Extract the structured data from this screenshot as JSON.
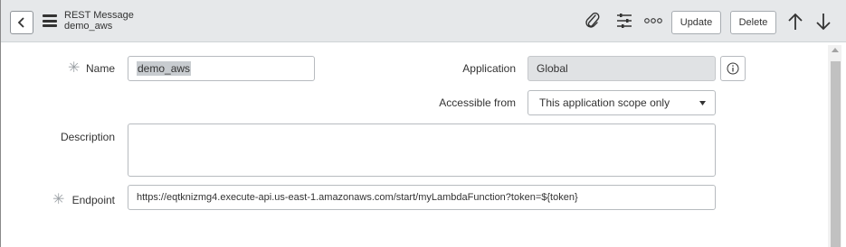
{
  "header": {
    "record_type": "REST Message",
    "record_name": "demo_aws",
    "update_label": "Update",
    "delete_label": "Delete",
    "icons": [
      "back-icon",
      "menu-icon",
      "paperclip-icon",
      "settings-sliders-icon",
      "more-options-icon",
      "arrow-up-icon",
      "arrow-down-icon"
    ]
  },
  "form": {
    "name_label": "Name",
    "name_value": "demo_aws",
    "application_label": "Application",
    "application_value": "Global",
    "accessible_from_label": "Accessible from",
    "accessible_from_value": "This application scope only",
    "description_label": "Description",
    "description_value": "",
    "endpoint_label": "Endpoint",
    "endpoint_value": "https://eqtknizmg4.execute-api.us-east-1.amazonaws.com/start/myLambdaFunction?token=${token}",
    "required_marker": "✳"
  },
  "colors": {
    "header_bg": "#e6e8ea",
    "readonly_bg": "#e0e2e4",
    "border": "#b7bbbf"
  }
}
